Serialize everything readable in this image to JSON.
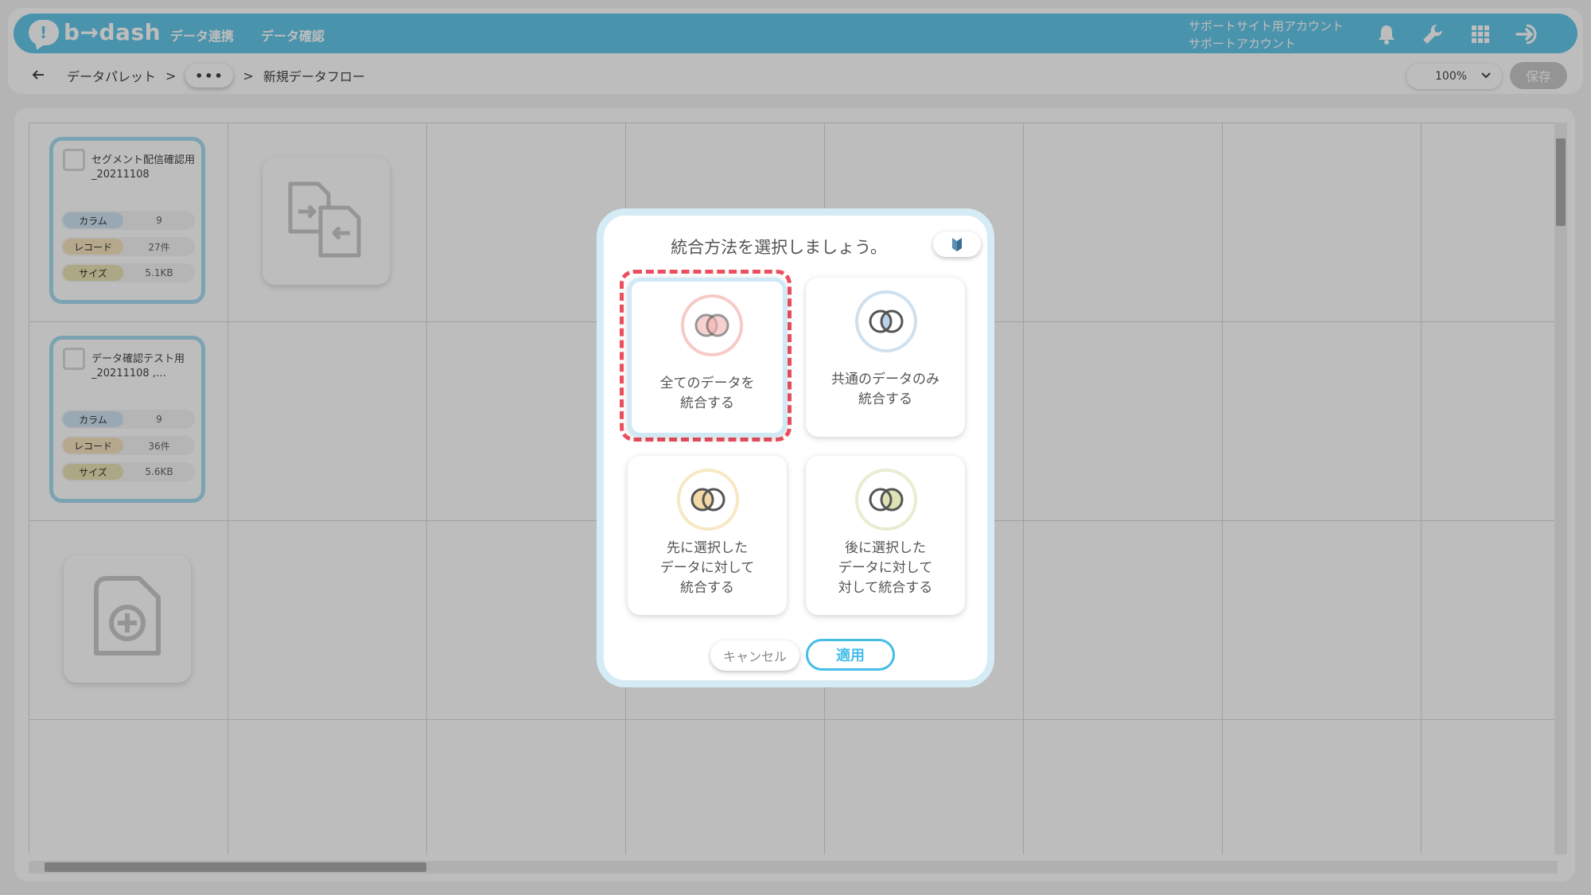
{
  "header": {
    "logo_mark": "!",
    "logo_text": "b→dash",
    "nav": [
      "データ連携",
      "データ確認"
    ],
    "account_line1": "サポートサイト用アカウント",
    "account_line2": "サポートアカウント",
    "icons": [
      "bell-icon",
      "wrench-icon",
      "grid-apps-icon",
      "logout-icon"
    ],
    "accent_color": "#64c7ea"
  },
  "breadcrumb": {
    "back_icon": "arrow-left-icon",
    "root": "データパレット",
    "sep": ">",
    "ellipsis": "•••",
    "current": "新規データフロー"
  },
  "toolbar": {
    "zoom": "100%",
    "save_label": "保存"
  },
  "data_cards": [
    {
      "title": "セグメント配信確認用_20211108",
      "stats": [
        {
          "label": "カラム",
          "value": "9",
          "color": "#cfe4f2"
        },
        {
          "label": "レコード",
          "value": "27件",
          "color": "#f6e3bf"
        },
        {
          "label": "サイズ",
          "value": "5.1KB",
          "color": "#e9e2b3"
        }
      ]
    },
    {
      "title": "データ確認テスト用_20211108 ,…",
      "stats": [
        {
          "label": "カラム",
          "value": "9",
          "color": "#cfe4f2"
        },
        {
          "label": "レコード",
          "value": "36件",
          "color": "#f6e3bf"
        },
        {
          "label": "サイズ",
          "value": "5.6KB",
          "color": "#e9e2b3"
        }
      ]
    }
  ],
  "modal": {
    "title": "統合方法を選択しましょう。",
    "help_icon": "beginner-mark-icon",
    "options": [
      {
        "line1": "全てのデータを",
        "line2": "統合する",
        "line3": "",
        "ring_color": "#f7c9c7",
        "fill_color": "#f3b3b0",
        "selected": true
      },
      {
        "line1": "共通のデータのみ",
        "line2": "統合する",
        "line3": "",
        "ring_color": "#cfe0ee",
        "fill_color": "#b9d3ea",
        "selected": false
      },
      {
        "line1": "先に選択した",
        "line2": "データに対して",
        "line3": "統合する",
        "ring_color": "#f7e8c4",
        "fill_color": "#f2d9a6",
        "selected": false
      },
      {
        "line1": "後に選択した",
        "line2": "データに対して",
        "line3": "対して統合する",
        "ring_color": "#eaecd2",
        "fill_color": "#dfe3b4",
        "selected": false
      }
    ],
    "cancel_label": "キャンセル",
    "apply_label": "適用",
    "highlight_color": "#ec4f5f"
  }
}
